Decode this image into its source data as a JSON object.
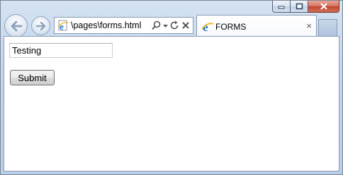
{
  "browser": {
    "address_bar": {
      "url": "\\pages\\forms.html",
      "icons": [
        "ie-page-icon",
        "search-icon",
        "dropdown-icon",
        "refresh-icon",
        "stop-icon"
      ]
    },
    "tab": {
      "title": "FORMS",
      "icon": "ie-page-icon",
      "close_glyph": "×"
    },
    "window_controls": [
      "minimize-icon",
      "maximize-icon",
      "close-icon"
    ],
    "nav_buttons": [
      "back-arrow-icon",
      "forward-arrow-icon"
    ]
  },
  "form": {
    "text_field_value": "Testing",
    "submit_label": "Submit"
  }
}
